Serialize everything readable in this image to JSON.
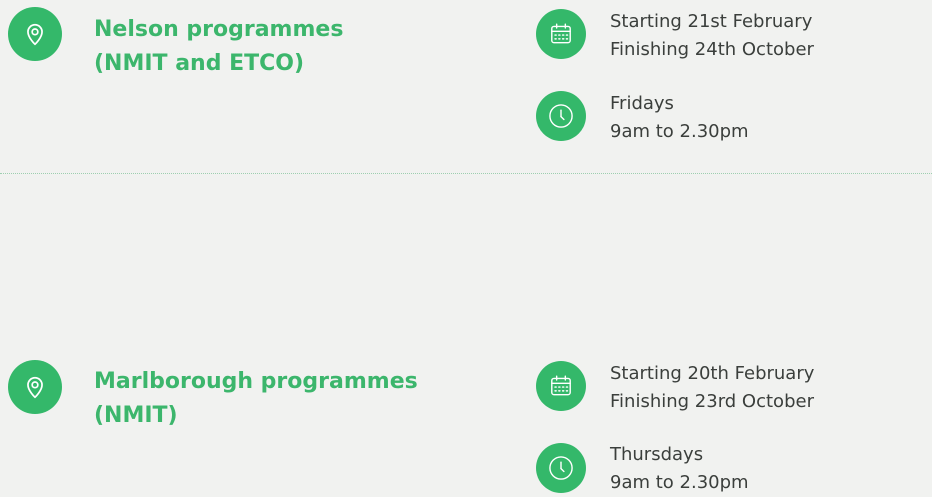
{
  "icon_color": "#34b86a",
  "title_color": "#3cb66c",
  "background": "#f1f2f0",
  "programmes": [
    {
      "title_lines": [
        "Nelson programmes",
        "(NMIT and ETCO)"
      ],
      "location_icon": "map-pin-icon",
      "dates": {
        "icon": "calendar-icon",
        "start": "Starting 21st February",
        "finish": "Finishing 24th October"
      },
      "schedule": {
        "icon": "clock-icon",
        "day": "Fridays",
        "time": "9am to 2.30pm"
      }
    },
    {
      "title_lines": [
        "Marlborough programmes",
        "(NMIT)"
      ],
      "location_icon": "map-pin-icon",
      "dates": {
        "icon": "calendar-icon",
        "start": "Starting 20th February",
        "finish": "Finishing 23rd October"
      },
      "schedule": {
        "icon": "clock-icon",
        "day": "Thursdays",
        "time": "9am to 2.30pm"
      }
    }
  ]
}
